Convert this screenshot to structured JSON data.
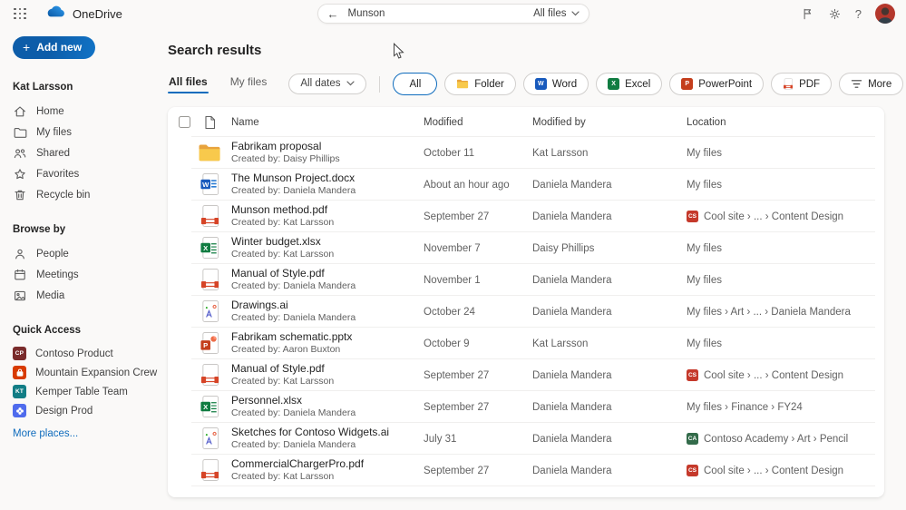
{
  "topbar": {
    "app_name": "OneDrive",
    "search": {
      "value": "Munson",
      "scope": "All files",
      "back_icon": "arrow-left-icon"
    },
    "icons": [
      "flag-icon",
      "gear-icon",
      "help-icon",
      "avatar"
    ]
  },
  "sidebar": {
    "add_new_label": "Add new",
    "user": {
      "label": "Kat Larsson",
      "items": [
        {
          "icon": "home",
          "label": "Home"
        },
        {
          "icon": "folder",
          "label": "My files"
        },
        {
          "icon": "people",
          "label": "Shared"
        },
        {
          "icon": "star",
          "label": "Favorites"
        },
        {
          "icon": "trash",
          "label": "Recycle bin"
        }
      ]
    },
    "browse_by": {
      "label": "Browse by",
      "items": [
        {
          "icon": "person",
          "label": "People"
        },
        {
          "icon": "calendar",
          "label": "Meetings"
        },
        {
          "icon": "media",
          "label": "Media"
        }
      ]
    },
    "quick_access": {
      "label": "Quick Access",
      "items": [
        {
          "initials": "CP",
          "color": "#7a2b2b",
          "label": "Contoso Product"
        },
        {
          "glyph": "backpack",
          "color": "#d83b01",
          "label": "Mountain Expansion Crew"
        },
        {
          "initials": "KT",
          "color": "#127d85",
          "label": "Kemper Table Team"
        },
        {
          "glyph": "pinwheel",
          "color": "#4f6bed",
          "label": "Design Prod"
        }
      ]
    },
    "more_places_label": "More places..."
  },
  "main": {
    "title": "Search results",
    "tabs": [
      {
        "label": "All files",
        "active": true
      },
      {
        "label": "My files",
        "active": false
      }
    ],
    "date_filter_label": "All dates",
    "filters": [
      {
        "label": "All",
        "selected": true
      },
      {
        "label": "Folder",
        "icon": "folder"
      },
      {
        "label": "Word",
        "icon": "word"
      },
      {
        "label": "Excel",
        "icon": "excel"
      },
      {
        "label": "PowerPoint",
        "icon": "powerpoint"
      },
      {
        "label": "PDF",
        "icon": "pdf"
      },
      {
        "label": "More",
        "icon": "filter"
      }
    ],
    "table": {
      "columns": [
        "Name",
        "Modified",
        "Modified by",
        "Location"
      ],
      "rows": [
        {
          "type": "folder",
          "name": "Fabrikam proposal",
          "created_by": "Created by: Daisy Phillips",
          "modified": "October 11",
          "modified_by": "Kat Larsson",
          "location": {
            "text": "My files"
          }
        },
        {
          "type": "word",
          "name": "The Munson Project.docx",
          "created_by": "Created by: Daniela Mandera",
          "modified": "About an hour ago",
          "modified_by": "Daniela Mandera",
          "location": {
            "text": "My files"
          }
        },
        {
          "type": "pdf",
          "name": "Munson method.pdf",
          "created_by": "Created by: Kat Larsson",
          "modified": "September 27",
          "modified_by": "Daniela Mandera",
          "location": {
            "badge": "CS",
            "badge_color": "#c5392b",
            "text": "Cool site › ... › Content Design"
          }
        },
        {
          "type": "excel",
          "name": "Winter budget.xlsx",
          "created_by": "Created by: Kat Larsson",
          "modified": "November 7",
          "modified_by": "Daisy Phillips",
          "location": {
            "text": "My files"
          }
        },
        {
          "type": "pdf",
          "name": "Manual of Style.pdf",
          "created_by": "Created by: Daniela Mandera",
          "modified": "November 1",
          "modified_by": "Daniela Mandera",
          "location": {
            "text": "My files"
          }
        },
        {
          "type": "ai",
          "name": "Drawings.ai",
          "created_by": "Created by: Daniela Mandera",
          "modified": "October 24",
          "modified_by": "Daniela Mandera",
          "location": {
            "text": "My files › Art › ... › Daniela Mandera"
          }
        },
        {
          "type": "powerpoint",
          "name": "Fabrikam schematic.pptx",
          "created_by": "Created by: Aaron Buxton",
          "modified": "October 9",
          "modified_by": "Kat Larsson",
          "location": {
            "text": "My files"
          }
        },
        {
          "type": "pdf",
          "name": "Manual of Style.pdf",
          "created_by": "Created by: Kat Larsson",
          "modified": "September 27",
          "modified_by": "Daniela Mandera",
          "location": {
            "badge": "CS",
            "badge_color": "#c5392b",
            "text": "Cool site › ... › Content Design"
          }
        },
        {
          "type": "excel",
          "name": "Personnel.xlsx",
          "created_by": "Created by: Daniela Mandera",
          "modified": "September 27",
          "modified_by": "Daniela Mandera",
          "location": {
            "text": "My files › Finance › FY24"
          }
        },
        {
          "type": "ai",
          "name": "Sketches for Contoso Widgets.ai",
          "created_by": "Created by: Daniela Mandera",
          "modified": "July 31",
          "modified_by": "Daniela Mandera",
          "location": {
            "badge": "CA",
            "badge_color": "#336b4a",
            "text": "Contoso Academy › Art › Pencil"
          }
        },
        {
          "type": "pdf",
          "name": "CommercialChargerPro.pdf",
          "created_by": "Created by: Kat Larsson",
          "modified": "September 27",
          "modified_by": "Daniela Mandera",
          "location": {
            "badge": "CS",
            "badge_color": "#c5392b",
            "text": "Cool site › ... › Content Design"
          }
        }
      ]
    }
  },
  "colors": {
    "accent": "#0f6cbd",
    "text_primary": "#242424",
    "text_secondary": "#616161",
    "card_bg": "#ffffff",
    "page_bg": "#faf9f8"
  }
}
